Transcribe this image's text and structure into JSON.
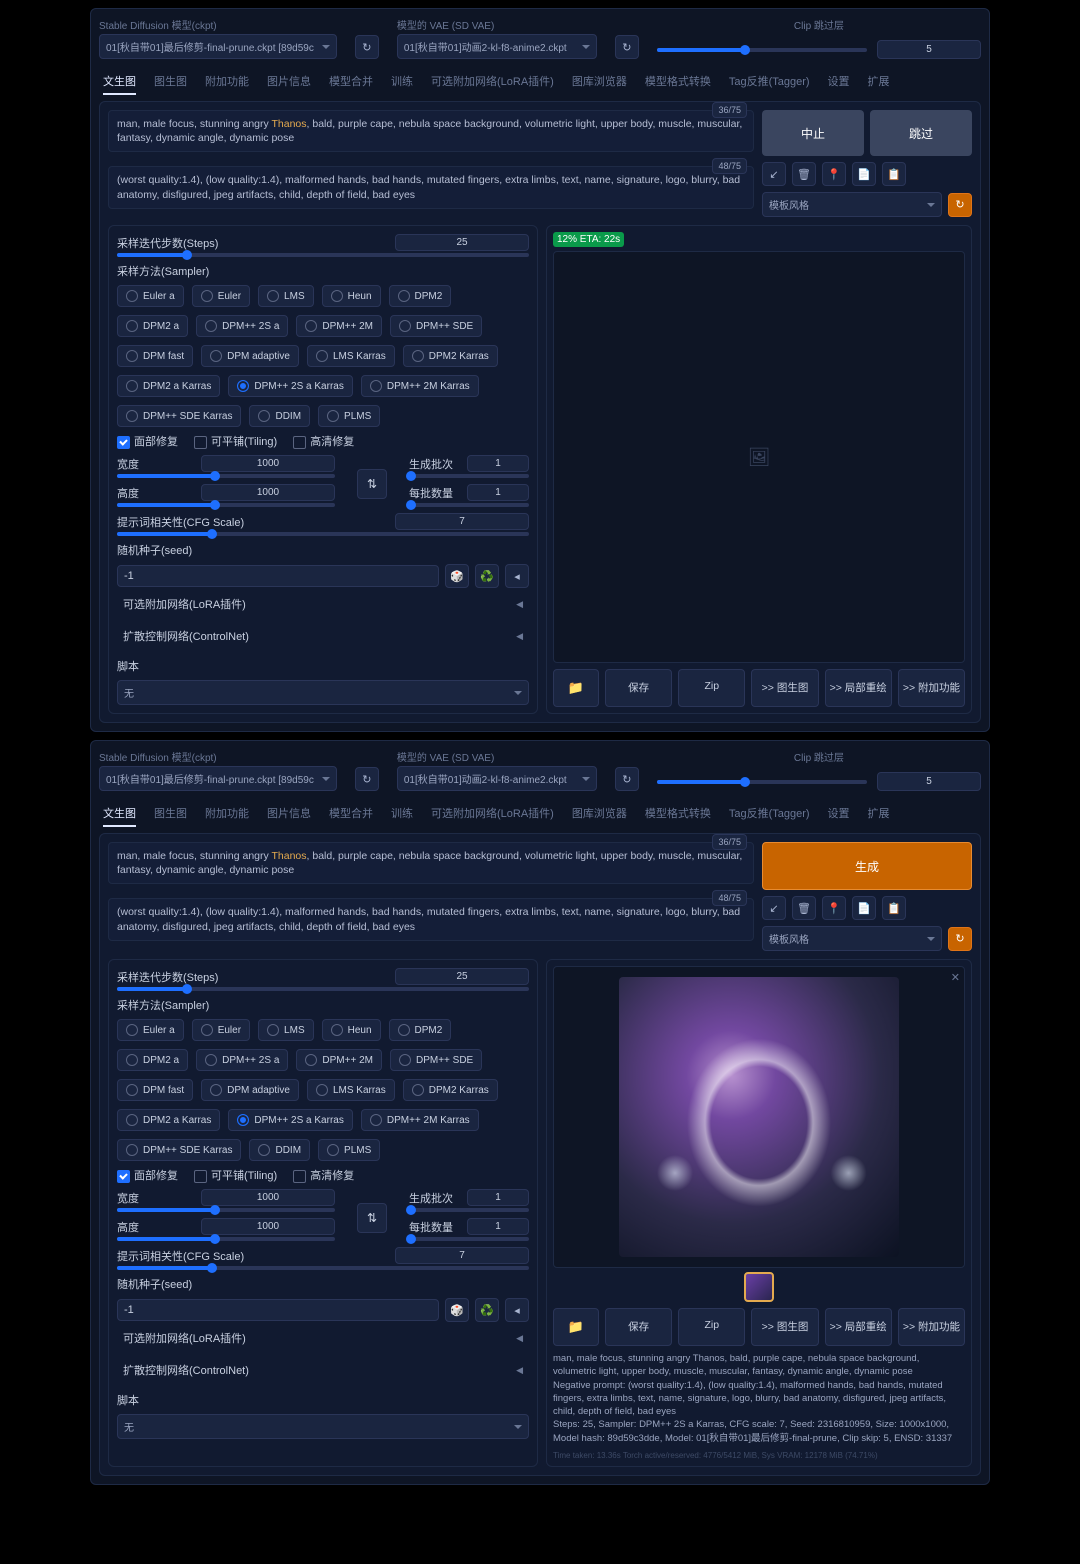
{
  "header": {
    "sd_label": "Stable Diffusion 模型(ckpt)",
    "sd_value": "01[秋自带01]最后修剪-final-prune.ckpt [89d59c",
    "vae_label": "模型的 VAE (SD VAE)",
    "vae_value": "01[秋自带01]动画2-kl-f8-anime2.ckpt",
    "clip_label": "Clip 跳过层",
    "clip_value": "5"
  },
  "tabs": [
    "文生图",
    "图生图",
    "附加功能",
    "图片信息",
    "模型合并",
    "训练",
    "可选附加网络(LoRA插件)",
    "图库浏览器",
    "模型格式转换",
    "Tag反推(Tagger)",
    "设置",
    "扩展"
  ],
  "prompt_pre": "man, male focus, stunning angry ",
  "prompt_hl": "Thanos",
  "prompt_post": ", bald, purple cape, nebula space background, volumetric light, upper body, muscle, muscular, fantasy, dynamic angle, dynamic pose",
  "prompt_tokens": "36/75",
  "neg": "(worst quality:1.4), (low quality:1.4), malformed hands, bad hands, mutated fingers, extra limbs, text, name, signature, logo, blurry, bad anatomy, disfigured, jpeg artifacts, child, depth of field, bad eyes",
  "neg_tokens": "48/75",
  "buttons": {
    "abort": "中止",
    "skip": "跳过",
    "generate": "生成"
  },
  "style_label": "模板风格",
  "steps": {
    "label": "采样迭代步数(Steps)",
    "value": "25"
  },
  "sampler": {
    "label": "采样方法(Sampler)",
    "options": [
      "Euler a",
      "Euler",
      "LMS",
      "Heun",
      "DPM2",
      "DPM2 a",
      "DPM++ 2S a",
      "DPM++ 2M",
      "DPM++ SDE",
      "DPM fast",
      "DPM adaptive",
      "LMS Karras",
      "DPM2 Karras",
      "DPM2 a Karras",
      "DPM++ 2S a Karras",
      "DPM++ 2M Karras",
      "DPM++ SDE Karras",
      "DDIM",
      "PLMS"
    ],
    "selected": "DPM++ 2S a Karras"
  },
  "checks": {
    "face": "面部修复",
    "tile": "可平铺(Tiling)",
    "hires": "高清修复"
  },
  "width": {
    "label": "宽度",
    "value": "1000"
  },
  "height": {
    "label": "高度",
    "value": "1000"
  },
  "batch_count": {
    "label": "生成批次",
    "value": "1"
  },
  "batch_size": {
    "label": "每批数量",
    "value": "1"
  },
  "cfg": {
    "label": "提示词相关性(CFG Scale)",
    "value": "7"
  },
  "seed": {
    "label": "随机种子(seed)",
    "value": "-1"
  },
  "acc": {
    "lora": "可选附加网络(LoRA插件)",
    "control": "扩散控制网络(ControlNet)",
    "script": "脚本",
    "script_value": "无"
  },
  "progress": "12% ETA: 22s",
  "save": {
    "folder": "📁",
    "save": "保存",
    "zip": "Zip",
    "img2img": ">> 图生图",
    "partial": ">> 局部重绘",
    "extras": ">> 附加功能"
  },
  "result_text": "man, male focus, stunning angry Thanos, bald, purple cape, nebula space background, volumetric light, upper body, muscle, muscular, fantasy, dynamic angle, dynamic pose",
  "result_neg": "Negative prompt: (worst quality:1.4), (low quality:1.4), malformed hands, bad hands, mutated fingers, extra limbs, text, name, signature, logo, blurry, bad anatomy, disfigured, jpeg artifacts, child, depth of field, bad eyes",
  "result_meta": "Steps: 25, Sampler: DPM++ 2S a Karras, CFG scale: 7, Seed: 2316810959, Size: 1000x1000, Model hash: 89d59c3dde, Model: 01[秋自带01]最后修剪-final-prune, Clip skip: 5, ENSD: 31337",
  "footer": "Time taken: 13.36s   Torch active/reserved: 4776/5412 MiB, Sys VRAM: 12178 MiB (74.71%)"
}
